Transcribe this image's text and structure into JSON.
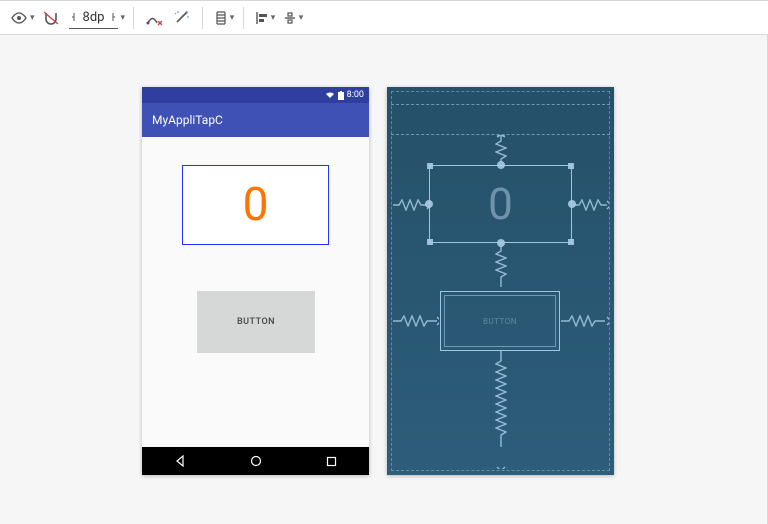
{
  "toolbar": {
    "grid_value": "8dp"
  },
  "preview": {
    "status_time": "8:00",
    "app_title": "MyAppliTapC",
    "textview_value": "0",
    "button_label": "BUTTON"
  },
  "blueprint": {
    "textview_value": "0",
    "button_label": "BUTTON"
  }
}
